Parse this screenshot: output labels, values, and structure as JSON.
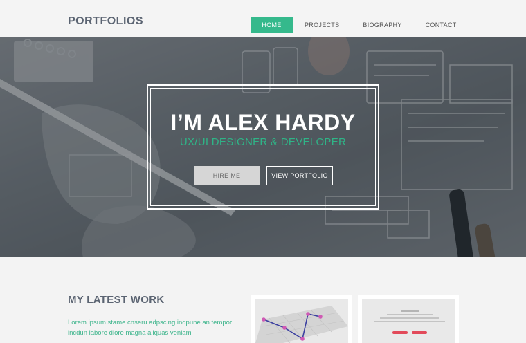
{
  "header": {
    "logo": "PORTFOLIOS",
    "nav": [
      {
        "label": "HOME",
        "active": true
      },
      {
        "label": "PROJECTS",
        "active": false
      },
      {
        "label": "BIOGRAPHY",
        "active": false
      },
      {
        "label": "CONTACT",
        "active": false
      }
    ]
  },
  "hero": {
    "title": "I’M ALEX HARDY",
    "subtitle": "UX/UI DESIGNER & DEVELOPER",
    "hire_label": "HIRE ME",
    "portfolio_label": "VIEW PORTFOLIO"
  },
  "work": {
    "title": "MY LATEST WORK",
    "text": "Lorem ipsum stame cnseru adpscing indpune an tempor incdun labore dlore magna aliquas veniam"
  },
  "colors": {
    "accent": "#35b98c",
    "heading": "#5b6472",
    "card_red": "#e24a5a"
  }
}
